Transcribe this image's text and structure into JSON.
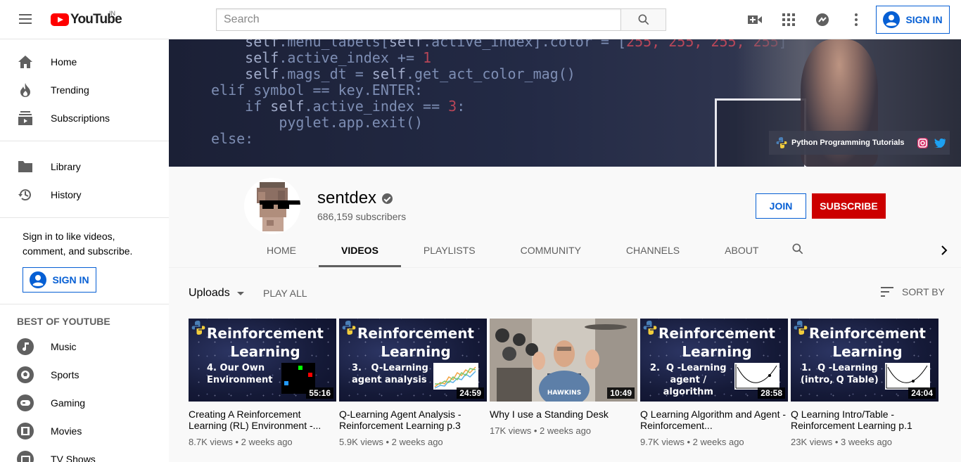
{
  "header": {
    "logo_text": "YouTube",
    "logo_country": "IN",
    "search_placeholder": "Search",
    "sign_in_label": "SIGN IN"
  },
  "sidebar": {
    "main_items": [
      {
        "label": "Home",
        "icon": "home-icon"
      },
      {
        "label": "Trending",
        "icon": "trending-icon"
      },
      {
        "label": "Subscriptions",
        "icon": "subscriptions-icon"
      }
    ],
    "library_items": [
      {
        "label": "Library",
        "icon": "library-icon"
      },
      {
        "label": "History",
        "icon": "history-icon"
      }
    ],
    "signin_prompt": "Sign in to like videos, comment, and subscribe.",
    "signin_button": "SIGN IN",
    "best_heading": "BEST OF YOUTUBE",
    "best_items": [
      {
        "label": "Music",
        "icon": "music-icon"
      },
      {
        "label": "Sports",
        "icon": "sports-icon"
      },
      {
        "label": "Gaming",
        "icon": "gaming-icon"
      },
      {
        "label": "Movies",
        "icon": "movies-icon"
      },
      {
        "label": "TV Shows",
        "icon": "tv-icon"
      }
    ]
  },
  "banner": {
    "link_text": "Python Programming Tutorials",
    "icons": [
      "instagram-icon",
      "twitter-icon"
    ]
  },
  "channel": {
    "name": "sentdex",
    "subscribers": "686,159 subscribers",
    "join_label": "JOIN",
    "subscribe_label": "SUBSCRIBE",
    "tabs": [
      "HOME",
      "VIDEOS",
      "PLAYLISTS",
      "COMMUNITY",
      "CHANNELS",
      "ABOUT"
    ],
    "active_tab": "VIDEOS"
  },
  "content": {
    "uploads_label": "Uploads",
    "play_all_label": "PLAY ALL",
    "sort_by_label": "SORT BY",
    "videos": [
      {
        "thumb_title_1": "Reinforcement",
        "thumb_title_2": "Learning",
        "thumb_sub": "4. Our Own\nEnvironment",
        "duration": "55:16",
        "title": "Creating A Reinforcement Learning (RL) Environment -...",
        "views": "8.7K views",
        "age": "2 weeks ago"
      },
      {
        "thumb_title_1": "Reinforcement",
        "thumb_title_2": "Learning",
        "thumb_sub": "3.   Q-Learning\nagent analysis",
        "duration": "24:59",
        "title": "Q-Learning Agent Analysis - Reinforcement Learning p.3",
        "views": "5.9K views",
        "age": "2 weeks ago"
      },
      {
        "thumb_title_1": "",
        "thumb_title_2": "",
        "thumb_sub": "",
        "duration": "10:49",
        "title": "Why I use a Standing Desk",
        "views": "17K views",
        "age": "2 weeks ago"
      },
      {
        "thumb_title_1": "Reinforcement",
        "thumb_title_2": "Learning",
        "thumb_sub": "2.  Q -Learning\nagent /\nalgorithm",
        "duration": "28:58",
        "title": "Q Learning Algorithm and Agent - Reinforcement...",
        "views": "9.7K views",
        "age": "2 weeks ago"
      },
      {
        "thumb_title_1": "Reinforcement",
        "thumb_title_2": "Learning",
        "thumb_sub": "1.  Q -Learning\n(intro, Q Table)",
        "duration": "24:04",
        "title": "Q Learning Intro/Table - Reinforcement Learning p.1",
        "views": "23K views",
        "age": "3 weeks ago"
      }
    ]
  },
  "colors": {
    "brand_red": "#ff0000",
    "subscribe_red": "#cc0000",
    "link_blue": "#065fd4"
  }
}
